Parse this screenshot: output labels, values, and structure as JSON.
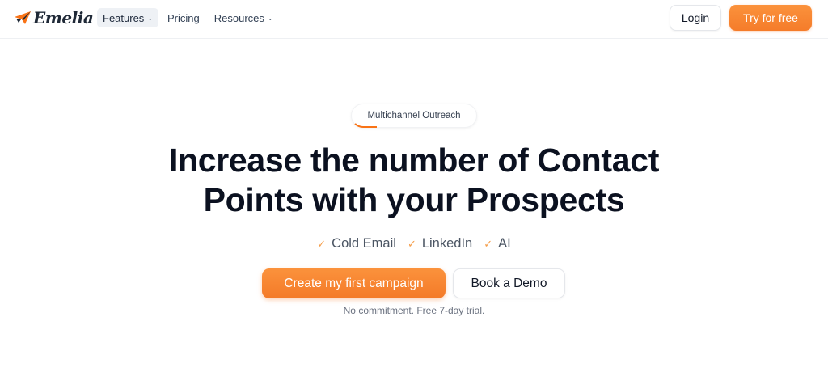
{
  "brand": {
    "logo_text": "Emelia",
    "accent_color": "#f97316",
    "logo_icon": "paper-plane-icon"
  },
  "nav": {
    "items": [
      {
        "label": "Features",
        "has_dropdown": true,
        "active": true
      },
      {
        "label": "Pricing",
        "has_dropdown": false,
        "active": false
      },
      {
        "label": "Resources",
        "has_dropdown": true,
        "active": false
      }
    ],
    "login_label": "Login",
    "try_label": "Try for free"
  },
  "hero": {
    "badge": "Multichannel Outreach",
    "headline_line1": "Increase the number of Contact",
    "headline_line2": "Points with your Prospects",
    "features": [
      {
        "icon": "check-icon",
        "label": "Cold Email"
      },
      {
        "icon": "check-icon",
        "label": "LinkedIn"
      },
      {
        "icon": "check-icon",
        "label": "AI"
      }
    ],
    "cta_primary": "Create my first campaign",
    "cta_secondary": "Book a Demo",
    "note": "No commitment. Free 7-day trial."
  }
}
